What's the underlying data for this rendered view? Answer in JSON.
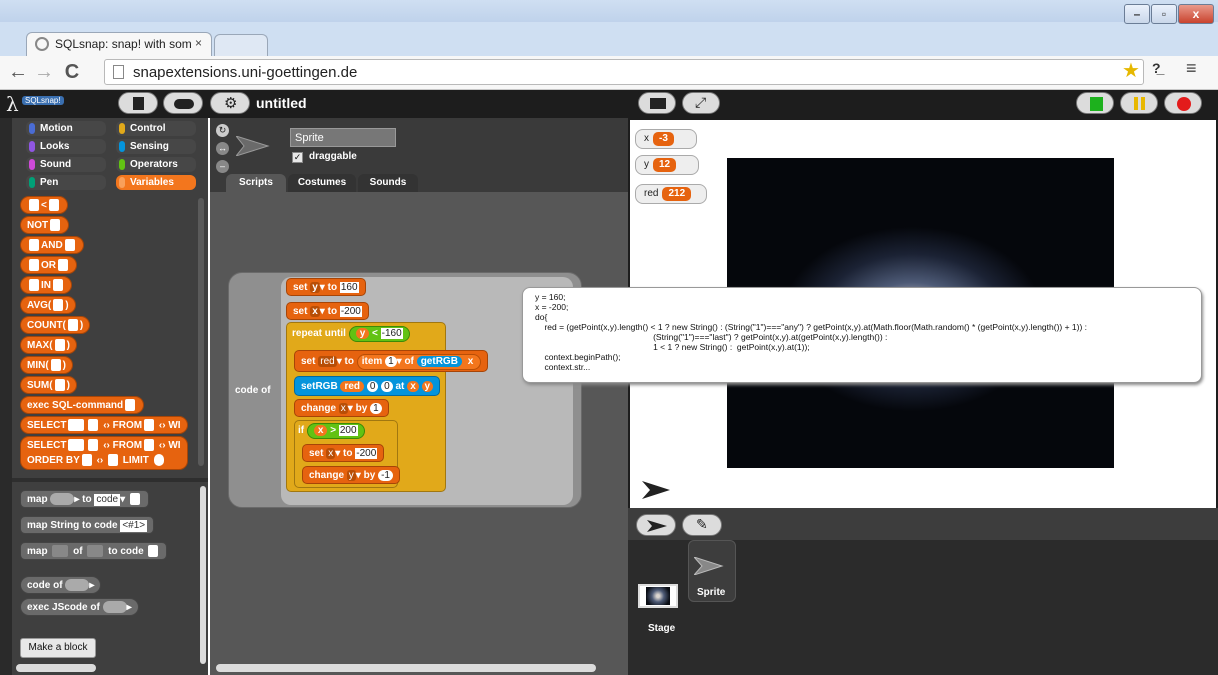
{
  "browser": {
    "tab_title": "SQLsnap: snap! with some",
    "url": "snapextensions.uni-goettingen.de",
    "minimize": "–",
    "maximize": "▫",
    "close": "x"
  },
  "snap": {
    "logo": "SQLsnap!",
    "project_title": "untitled",
    "categories": [
      {
        "label": "Motion",
        "color": "#4a6cd4"
      },
      {
        "label": "Control",
        "color": "#e1a91a"
      },
      {
        "label": "Looks",
        "color": "#8f56e3"
      },
      {
        "label": "Sensing",
        "color": "#0494dc"
      },
      {
        "label": "Sound",
        "color": "#cf4ad9"
      },
      {
        "label": "Operators",
        "color": "#62c213"
      },
      {
        "label": "Pen",
        "color": "#00a178"
      },
      {
        "label": "Variables",
        "color": "#f3761d"
      }
    ],
    "palette_blocks": [
      {
        "label": "<"
      },
      {
        "label": "NOT"
      },
      {
        "label": "AND"
      },
      {
        "label": "OR"
      },
      {
        "label": "IN"
      },
      {
        "label": "AVG("
      },
      {
        "label": "COUNT("
      },
      {
        "label": "MAX("
      },
      {
        "label": "MIN("
      },
      {
        "label": "SUM("
      },
      {
        "label": "exec SQL-command"
      },
      {
        "label": "SELECT"
      },
      {
        "label": "FROM"
      },
      {
        "label": "WI"
      },
      {
        "label": "SELECT"
      },
      {
        "label": "FROM"
      },
      {
        "label": "WI"
      },
      {
        "label": "ORDER BY"
      },
      {
        "label": "LIMIT"
      }
    ],
    "palette_other": {
      "map1": "map",
      "to": "to",
      "code": "code",
      "map_string": "map String to code",
      "hash": "<#1>",
      "map2": "map",
      "of": "of",
      "to_code": "to code",
      "code_of": "code of",
      "exec_js": "exec JScode of",
      "make_block": "Make a block"
    },
    "sprite_name": "Sprite",
    "draggable_label": "draggable",
    "tabs": [
      "Scripts",
      "Costumes",
      "Sounds"
    ],
    "script": {
      "code_of": "code of",
      "set": "set",
      "to": "to",
      "var_y": "y",
      "val_160": "160",
      "var_x": "x",
      "val_m200": "-200",
      "repeat_until": "repeat until",
      "lt": "<",
      "val_m160": "-160",
      "set2": "set",
      "var_red": "red",
      "to2": "to",
      "item": "item",
      "one": "1",
      "of": "of",
      "getRGB": "getRGB",
      "x1": "x",
      "setRGB": "setRGB",
      "red": "red",
      "zero1": "0",
      "zero2": "0",
      "at": "at",
      "x2": "x",
      "y2": "y",
      "change": "change",
      "var_x2": "x",
      "by": "by",
      "one2": "1",
      "if": "if",
      "x3": "x",
      "gt": ">",
      "val_200": "200",
      "set3": "set",
      "var_x3": "x",
      "to3": "to",
      "val_m200b": "-200",
      "change2": "change",
      "var_y2": "y",
      "by2": "by",
      "val_m1": "-1"
    },
    "tooltip": "y = 160;\nx = -200;\ndo{\n    red = (getPoint(x,y).length() < 1 ? new String() : (String(\"1\")===\"any\") ? getPoint(x,y).at(Math.floor(Math.random() * (getPoint(x,y).length()) + 1)) :\n                                                  (String(\"1\")===\"last\") ? getPoint(x,y).at(getPoint(x,y).length()) :\n                                                  1 < 1 ? new String() :  getPoint(x,y).at(1));\n    context.beginPath();\n    context.str...",
    "watchers": [
      {
        "name": "x",
        "value": "-3"
      },
      {
        "name": "y",
        "value": "12"
      },
      {
        "name": "red",
        "value": "212"
      }
    ],
    "corral": {
      "sprite_label": "Sprite",
      "stage_label": "Stage"
    }
  }
}
